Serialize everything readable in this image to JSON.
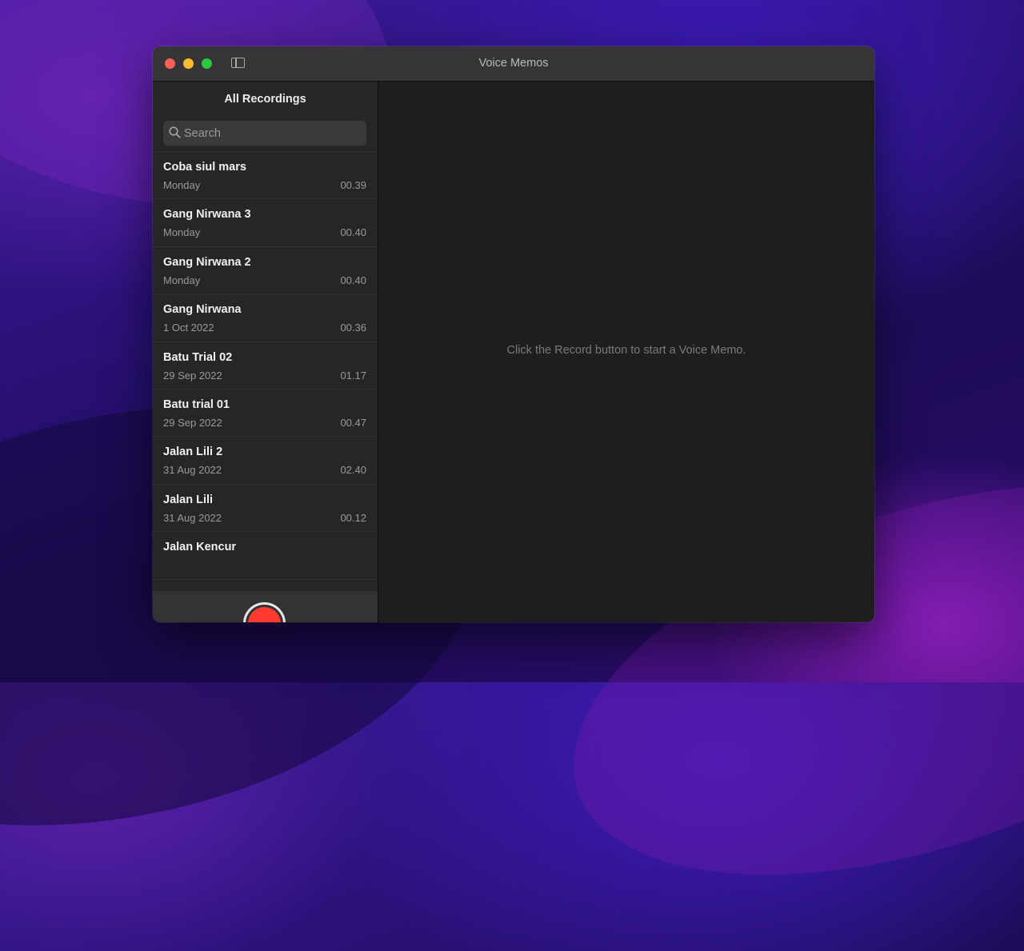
{
  "window": {
    "title": "Voice Memos"
  },
  "sidebar": {
    "header": "All Recordings",
    "search": {
      "placeholder": "Search",
      "value": ""
    },
    "recordings": [
      {
        "title": "Coba siul mars",
        "date": "Monday",
        "duration": "00.39"
      },
      {
        "title": "Gang Nirwana 3",
        "date": "Monday",
        "duration": "00.40"
      },
      {
        "title": "Gang Nirwana 2",
        "date": "Monday",
        "duration": "00.40"
      },
      {
        "title": "Gang Nirwana",
        "date": "1 Oct 2022",
        "duration": "00.36"
      },
      {
        "title": "Batu Trial 02",
        "date": "29 Sep 2022",
        "duration": "01.17"
      },
      {
        "title": "Batu trial 01",
        "date": "29 Sep 2022",
        "duration": "00.47"
      },
      {
        "title": "Jalan Lili 2",
        "date": "31 Aug 2022",
        "duration": "02.40"
      },
      {
        "title": "Jalan Lili",
        "date": "31 Aug 2022",
        "duration": "00.12"
      },
      {
        "title": "Jalan Kencur",
        "date": "",
        "duration": ""
      }
    ]
  },
  "main": {
    "empty_message": "Click the Record button to start a Voice Memo."
  },
  "colors": {
    "record": "#ff3b30",
    "close": "#ff5f57",
    "minimize": "#febc2e",
    "maximize": "#28c840"
  },
  "icons": {
    "search": "search-icon",
    "sidebar_toggle": "sidebar-toggle-icon",
    "record": "record-icon"
  }
}
